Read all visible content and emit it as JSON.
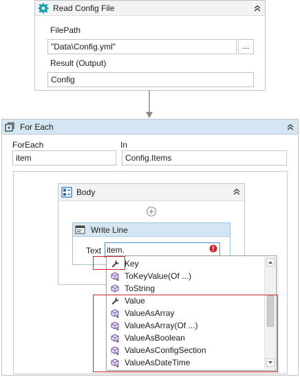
{
  "read_config": {
    "title": "Read Config File",
    "filepath_label": "FilePath",
    "filepath_value": "\"Data\\Config.yml\"",
    "browse_label": "...",
    "result_label": "Result (Output)",
    "result_value": "Config",
    "icon": "gear-icon"
  },
  "for_each": {
    "title": "For Each",
    "foreach_label": "ForEach",
    "foreach_value": "item",
    "in_label": "In",
    "in_value": "Config.Items",
    "icon": "loop-icon"
  },
  "body": {
    "title": "Body",
    "add_icon": "plus-circle-icon"
  },
  "write_line": {
    "title": "Write Line",
    "text_label": "Text",
    "text_value": "item.",
    "error_icon": "error-icon"
  },
  "autocomplete": {
    "items": [
      {
        "label": "Key",
        "icon": "wrench-icon"
      },
      {
        "label": "ToKeyValue(Of ...)",
        "icon": "method-icon"
      },
      {
        "label": "ToString",
        "icon": "method-icon"
      },
      {
        "label": "Value",
        "icon": "wrench-icon"
      },
      {
        "label": "ValueAsArray",
        "icon": "method-icon"
      },
      {
        "label": "ValueAsArray(Of ...)",
        "icon": "method-icon"
      },
      {
        "label": "ValueAsBoolean",
        "icon": "method-icon"
      },
      {
        "label": "ValueAsConfigSection",
        "icon": "method-icon"
      },
      {
        "label": "ValueAsDateTime",
        "icon": "method-icon"
      }
    ]
  },
  "colors": {
    "header_blue": "#d5e6f3",
    "header_gray": "#f3f3f3",
    "highlight_red": "#d6202f",
    "method_purple": "#6b4fa1",
    "gear_teal": "#1aa0a8"
  }
}
